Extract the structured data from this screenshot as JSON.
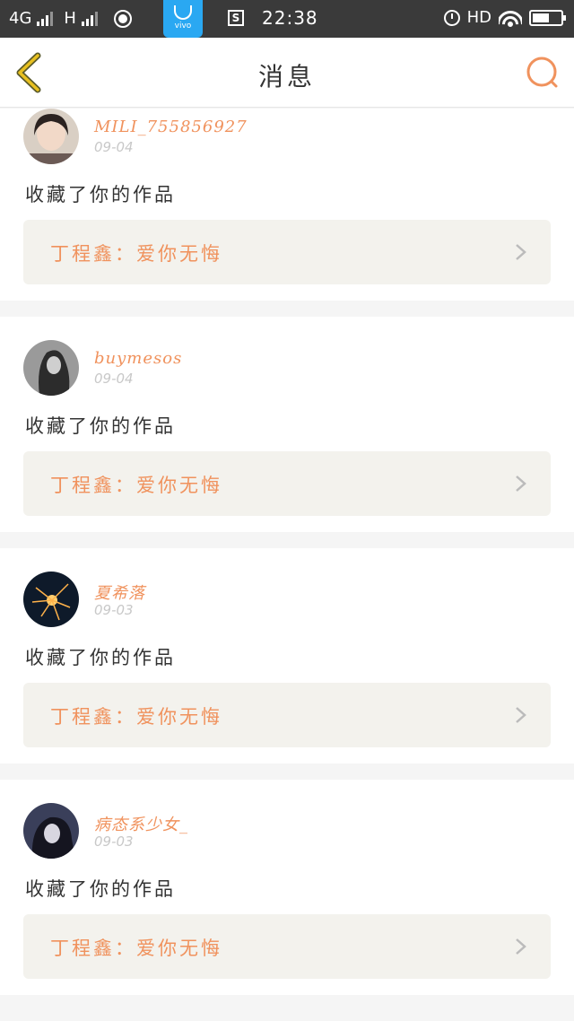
{
  "status_bar": {
    "network": "4G",
    "network2": "H",
    "store_label": "vivo",
    "s_icon": "S",
    "time": "22:38",
    "hd": "HD",
    "battery_level": 0.6
  },
  "nav": {
    "title": "消息",
    "back_icon": "chevron-left-icon",
    "search_icon": "search-icon"
  },
  "notifications": [
    {
      "username": "MILI_755856927",
      "date": "09-04",
      "action": "收藏了你的作品",
      "work": "丁程鑫：爱你无悔"
    },
    {
      "username": "buymesos",
      "date": "09-04",
      "action": "收藏了你的作品",
      "work": "丁程鑫：爱你无悔"
    },
    {
      "username": "夏希落",
      "date": "09-03",
      "action": "收藏了你的作品",
      "work": "丁程鑫：爱你无悔"
    },
    {
      "username": "病态系少女_",
      "date": "09-03",
      "action": "收藏了你的作品",
      "work": "丁程鑫：爱你无悔"
    }
  ],
  "colors": {
    "accent": "#f0925d",
    "back_arrow": "#e8a317",
    "status_bar": "#3a3a3a",
    "link_bg": "#f3f2ed"
  }
}
